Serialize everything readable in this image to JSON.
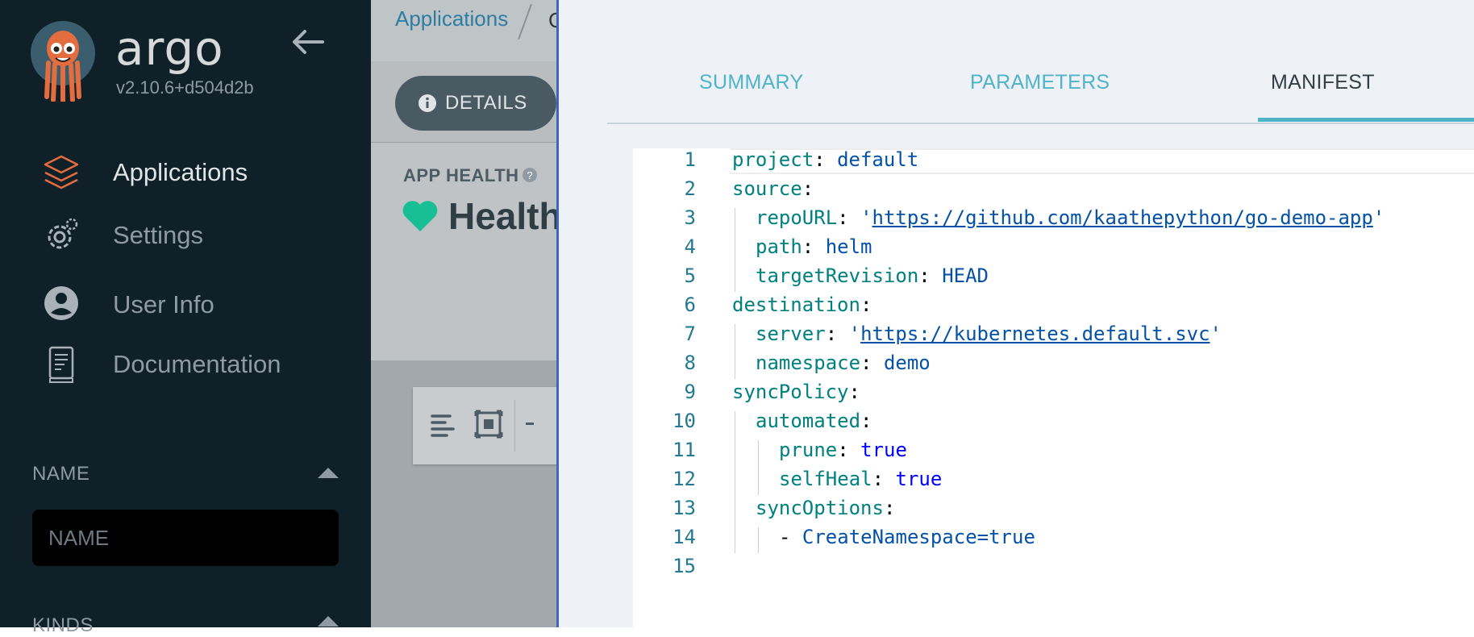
{
  "sidebar": {
    "brand": "argo",
    "version": "v2.10.6+d504d2b",
    "nav": [
      {
        "label": "Applications",
        "icon": "stack-icon"
      },
      {
        "label": "Settings",
        "icon": "gear-icon"
      },
      {
        "label": "User Info",
        "icon": "user-circle-icon"
      },
      {
        "label": "Documentation",
        "icon": "book-icon"
      }
    ],
    "filters": {
      "name_title": "NAME",
      "name_placeholder": "NAME",
      "kinds_title": "KINDS"
    }
  },
  "background": {
    "breadcrumb": "Applications",
    "breadcrumb_next": "C",
    "details_label": "DETAILS",
    "app_health_title": "APP HEALTH",
    "app_health_value": "Healthy"
  },
  "panel": {
    "tabs": [
      "SUMMARY",
      "PARAMETERS",
      "MANIFEST"
    ],
    "active_tab": "MANIFEST",
    "manifest_lines": [
      {
        "num": "1",
        "key": "project",
        "value": "default"
      },
      {
        "num": "2",
        "key": "source"
      },
      {
        "num": "3",
        "key": "repoURL",
        "url": "https://github.com/kaathepython/go-demo-app"
      },
      {
        "num": "4",
        "key": "path",
        "value": "helm"
      },
      {
        "num": "5",
        "key": "targetRevision",
        "value": "HEAD"
      },
      {
        "num": "6",
        "key": "destination"
      },
      {
        "num": "7",
        "key": "server",
        "url": "https://kubernetes.default.svc"
      },
      {
        "num": "8",
        "key": "namespace",
        "value": "demo"
      },
      {
        "num": "9",
        "key": "syncPolicy"
      },
      {
        "num": "10",
        "key": "automated"
      },
      {
        "num": "11",
        "key": "prune",
        "bool": "true"
      },
      {
        "num": "12",
        "key": "selfHeal",
        "bool": "true"
      },
      {
        "num": "13",
        "key": "syncOptions"
      },
      {
        "num": "14",
        "item": "CreateNamespace=true"
      },
      {
        "num": "15"
      }
    ]
  },
  "colors": {
    "sidebar_bg": "#0f2029",
    "accent_teal": "#4fb3c9",
    "panel_bg": "#eef2f6",
    "health_green": "#18be94"
  }
}
